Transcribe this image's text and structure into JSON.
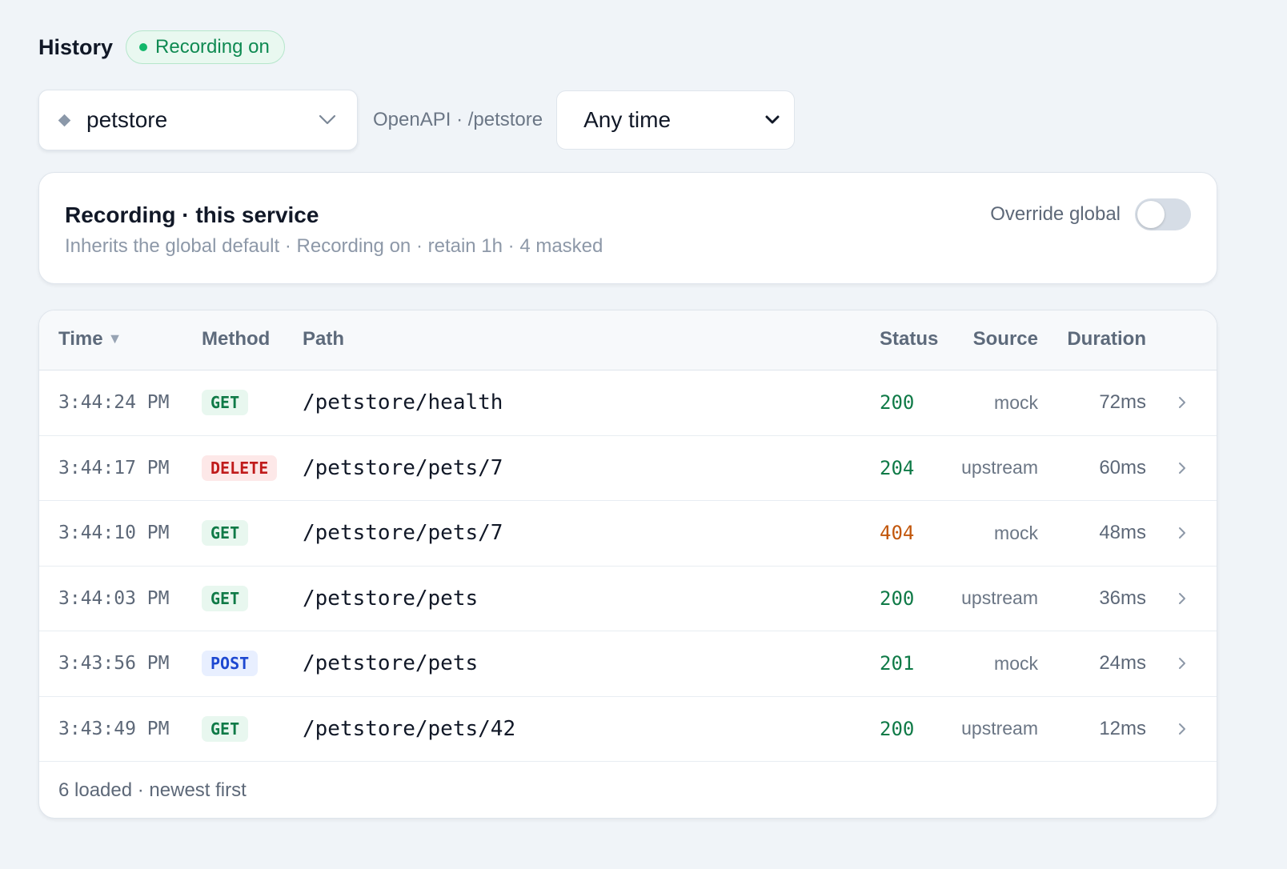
{
  "header": {
    "title": "History",
    "recording_badge": "Recording on"
  },
  "controls": {
    "service": "petstore",
    "service_meta": "OpenAPI · /petstore",
    "time_range": "Any time"
  },
  "recording_card": {
    "title": "Recording · this service",
    "subtitle": "Inherits the global default · Recording on · retain 1h · 4 masked",
    "override_label": "Override global",
    "override_enabled": false
  },
  "table": {
    "columns": {
      "time": "Time",
      "method": "Method",
      "path": "Path",
      "status": "Status",
      "source": "Source",
      "duration": "Duration"
    },
    "sort_indicator": "▼",
    "rows": [
      {
        "time": "3:44:24 PM",
        "method": "GET",
        "path": "/petstore/health",
        "status": "200",
        "source": "mock",
        "duration": "72ms"
      },
      {
        "time": "3:44:17 PM",
        "method": "DELETE",
        "path": "/petstore/pets/7",
        "status": "204",
        "source": "upstream",
        "duration": "60ms"
      },
      {
        "time": "3:44:10 PM",
        "method": "GET",
        "path": "/petstore/pets/7",
        "status": "404",
        "source": "mock",
        "duration": "48ms"
      },
      {
        "time": "3:44:03 PM",
        "method": "GET",
        "path": "/petstore/pets",
        "status": "200",
        "source": "upstream",
        "duration": "36ms"
      },
      {
        "time": "3:43:56 PM",
        "method": "POST",
        "path": "/petstore/pets",
        "status": "201",
        "source": "mock",
        "duration": "24ms"
      },
      {
        "time": "3:43:49 PM",
        "method": "GET",
        "path": "/petstore/pets/42",
        "status": "200",
        "source": "upstream",
        "duration": "12ms"
      }
    ],
    "footer": "6 loaded · newest first"
  },
  "colors": {
    "recording_green": "#12b76a",
    "status_ok": "#0f7a47",
    "status_warn": "#c2570c",
    "method_get": "#0f7a47",
    "method_delete": "#c01b1b",
    "method_post": "#1d48d1"
  },
  "icons": {
    "service_icon": "diamond-icon",
    "dropdown_icon": "chevron-down-icon",
    "row_icon": "chevron-right-icon"
  }
}
